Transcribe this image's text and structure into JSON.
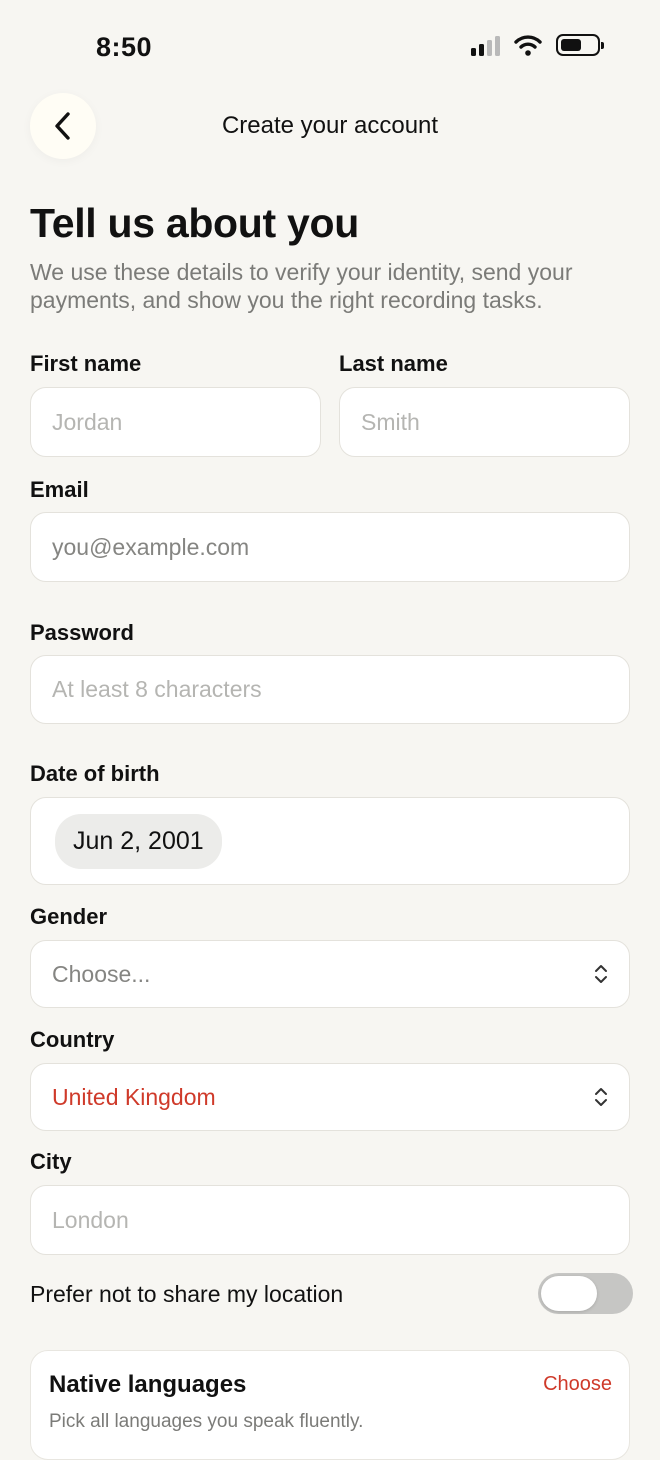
{
  "status_bar": {
    "time": "8:50"
  },
  "nav": {
    "title": "Create your account"
  },
  "intro": {
    "heading": "Tell us about you",
    "subtitle": "We use these details to verify your identity, send your payments, and show you the right recording tasks."
  },
  "form": {
    "first_name": {
      "label": "First name",
      "placeholder": "Jordan"
    },
    "last_name": {
      "label": "Last name",
      "placeholder": "Smith"
    },
    "email": {
      "label": "Email",
      "placeholder": "you@example.com"
    },
    "password": {
      "label": "Password",
      "placeholder": "At least 8 characters"
    },
    "dob": {
      "label": "Date of birth",
      "value": "Jun 2, 2001"
    },
    "gender": {
      "label": "Gender",
      "value": "Choose..."
    },
    "country": {
      "label": "Country",
      "value": "United Kingdom"
    },
    "city": {
      "label": "City",
      "placeholder": "London"
    },
    "location_toggle": {
      "label": "Prefer not to share my location",
      "on": false
    }
  },
  "languages": {
    "title": "Native languages",
    "action": "Choose",
    "hint": "Pick all languages you speak fluently."
  },
  "colors": {
    "accent": "#cf3a2a",
    "background": "#f7f6f2"
  }
}
